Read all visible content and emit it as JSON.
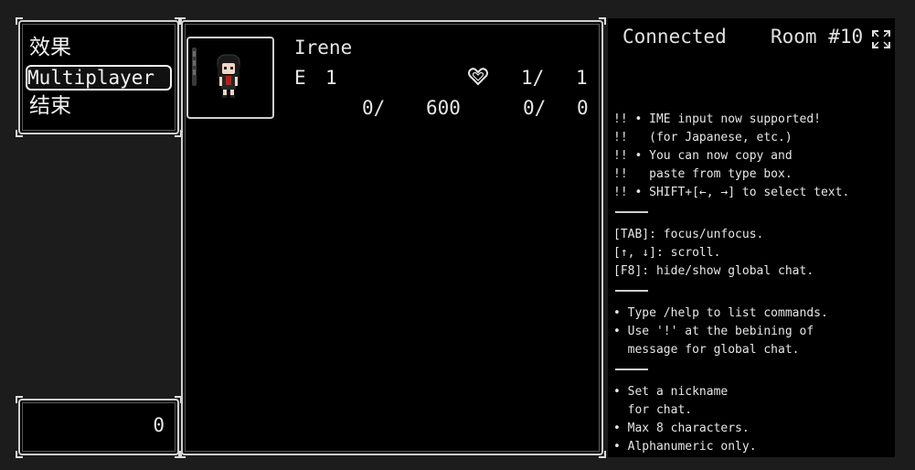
{
  "menu": {
    "items": [
      {
        "label": "效果"
      },
      {
        "label": "Multiplayer"
      },
      {
        "label": "结束"
      }
    ]
  },
  "gold": {
    "value": "0"
  },
  "actor": {
    "name": "Irene",
    "level_label": "E",
    "level": "1",
    "hp_icon": "heart-icon",
    "hp_current": "1/",
    "hp_max": "1",
    "exp_current": "0/",
    "exp_next": "600",
    "mp_current": "0/",
    "mp_max": "0"
  },
  "chat": {
    "status": "Connected",
    "room": "Room #10",
    "lines": [
      "!! • IME input now supported!",
      "!!   (for Japanese, etc.)",
      "!! • You can now copy and",
      "!!   paste from type box.",
      "!! • SHIFT+[←, →] to select text.",
      "[TAB]: focus/unfocus.",
      "[↑, ↓]: scroll.",
      "[F8]: hide/show global chat.",
      "• Type /help to list commands.",
      "• Use '!' at the bebining of",
      "  message for global chat.",
      "• Set a nickname",
      "  for chat.",
      "• Max 8 characters.",
      "• Alphanumeric only."
    ]
  },
  "colors": {
    "background": "#1c1c1c",
    "window": "#000000",
    "border": "#cfcfcf",
    "text": "#e6e6e6"
  }
}
